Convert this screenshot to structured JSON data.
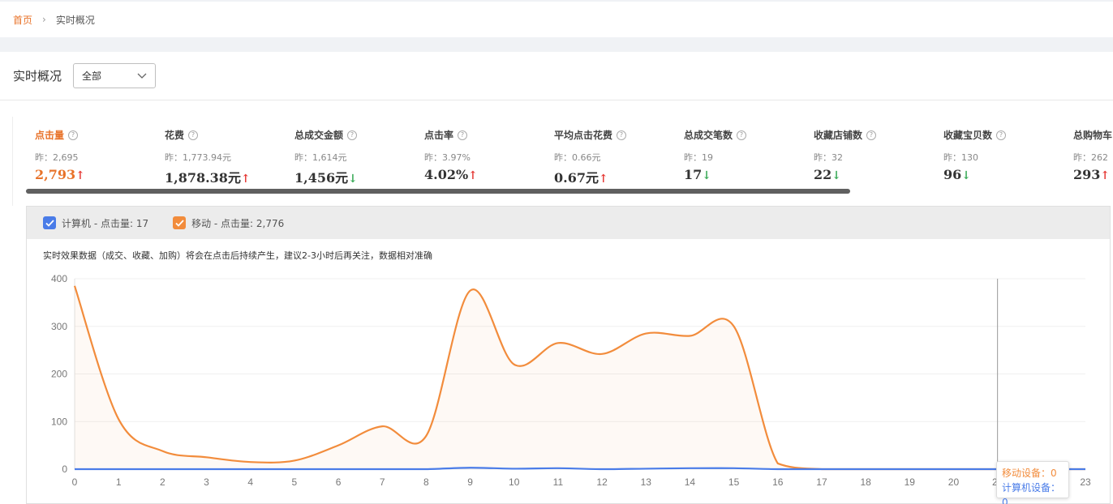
{
  "breadcrumb": {
    "home": "首页",
    "separator": "›",
    "current": "实时概况"
  },
  "header": {
    "title": "实时概况",
    "select_value": "全部"
  },
  "metrics": [
    {
      "label": "点击量",
      "yesterday": "昨：2,695",
      "value": "2,793",
      "trend": "up",
      "active": true
    },
    {
      "label": "花费",
      "yesterday": "昨：1,773.94元",
      "value": "1,878.38元",
      "trend": "up"
    },
    {
      "label": "总成交金额",
      "yesterday": "昨：1,614元",
      "value": "1,456元",
      "trend": "down"
    },
    {
      "label": "点击率",
      "yesterday": "昨：3.97%",
      "value": "4.02%",
      "trend": "up"
    },
    {
      "label": "平均点击花费",
      "yesterday": "昨：0.66元",
      "value": "0.67元",
      "trend": "up"
    },
    {
      "label": "总成交笔数",
      "yesterday": "昨：19",
      "value": "17",
      "trend": "down"
    },
    {
      "label": "收藏店铺数",
      "yesterday": "昨：32",
      "value": "22",
      "trend": "down"
    },
    {
      "label": "收藏宝贝数",
      "yesterday": "昨：130",
      "value": "96",
      "trend": "down"
    },
    {
      "label": "总购物车",
      "yesterday": "昨：262",
      "value": "293",
      "trend": "up"
    }
  ],
  "chart_panel": {
    "legend": [
      {
        "label": "计算机 - 点击量: 17",
        "color": "#4a7ce8",
        "checked": true
      },
      {
        "label": "移动 - 点击量: 2,776",
        "color": "#f28c3c",
        "checked": true
      }
    ],
    "notice": "实时效果数据（成交、收藏、加购）将会在点击后持续产生，建议2-3小时后再关注，数据相对准确"
  },
  "tooltip": {
    "mobile": "移动设备：0",
    "pc": "计算机设备：0"
  },
  "chart_data": {
    "type": "area",
    "x": [
      0,
      1,
      2,
      3,
      4,
      5,
      6,
      7,
      8,
      9,
      10,
      11,
      12,
      13,
      14,
      15,
      16,
      17,
      18,
      19,
      20,
      21,
      22,
      23
    ],
    "ylim": [
      0,
      400
    ],
    "yticks": [
      0,
      100,
      200,
      300,
      400
    ],
    "grid": true,
    "series": [
      {
        "name": "移动",
        "color": "#f28c3c",
        "values": [
          385,
          105,
          38,
          25,
          15,
          18,
          50,
          90,
          70,
          375,
          220,
          265,
          242,
          285,
          280,
          300,
          12,
          0,
          0,
          0,
          0,
          0,
          0,
          0
        ]
      },
      {
        "name": "计算机",
        "color": "#4a7ce8",
        "values": [
          0,
          0,
          0,
          0,
          0,
          0,
          0,
          0,
          0,
          3,
          1,
          2,
          0,
          1,
          2,
          2,
          0,
          0,
          0,
          0,
          0,
          0,
          0,
          0
        ]
      }
    ],
    "hover_x": 21
  }
}
